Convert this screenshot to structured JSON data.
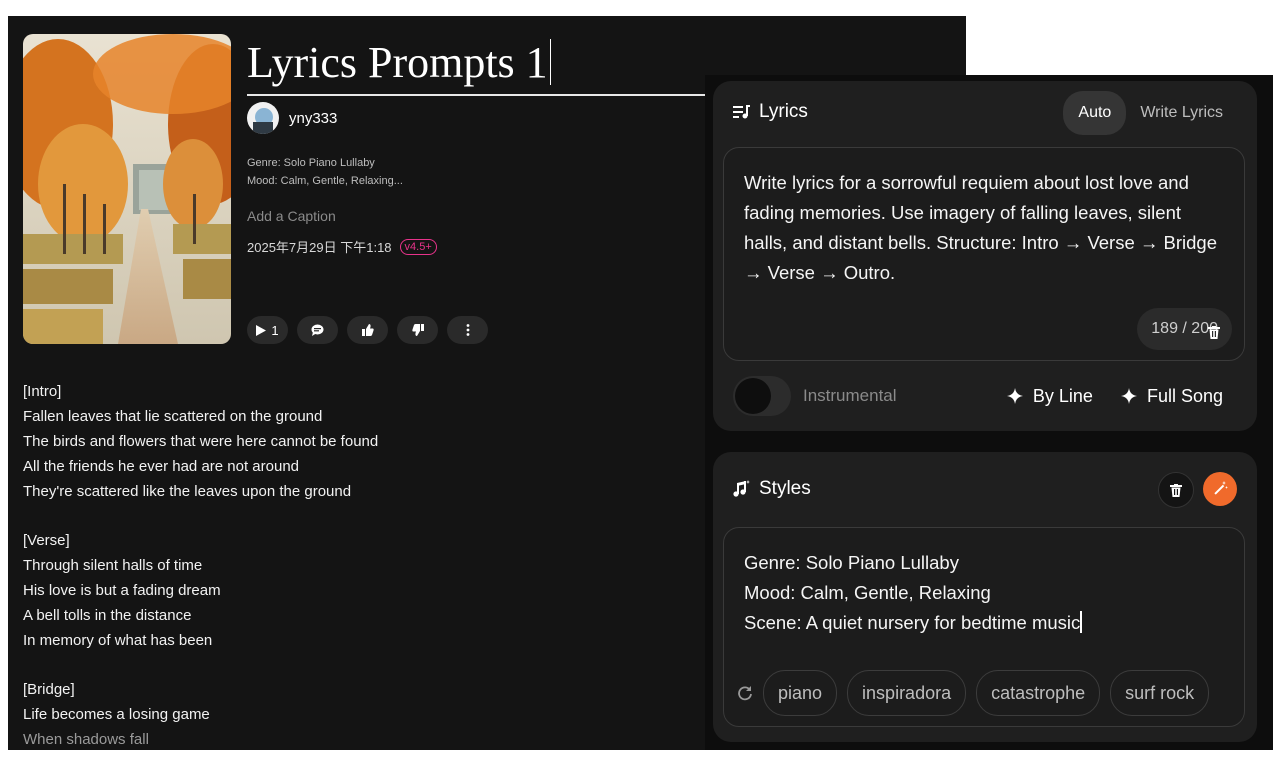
{
  "song": {
    "title": "Lyrics Prompts 1",
    "author": "yny333",
    "genre_line": "Genre: Solo Piano Lullaby",
    "mood_line": "Mood: Calm, Gentle, Relaxing...",
    "caption_placeholder": "Add a Caption",
    "date": "2025年7月29日 下午1:18",
    "version_badge": "v4.5+",
    "play_count": "1",
    "actions": {
      "play_icon": "play-icon",
      "comment_icon": "comment-icon",
      "like_icon": "thumbs-up-icon",
      "dislike_icon": "thumbs-down-icon",
      "more_icon": "more-vertical-icon"
    },
    "lyrics_lines": [
      "[Intro]",
      "Fallen leaves that lie scattered on the ground",
      "The birds and flowers that were here cannot be found",
      "All the friends he ever had are not around",
      "They're scattered like the leaves upon the ground",
      "",
      "[Verse]",
      "Through silent halls of time",
      "His love is but a fading dream",
      "A bell tolls in the distance",
      "In memory of what has been",
      "",
      "[Bridge]",
      "Life becomes a losing game",
      "When shadows fall"
    ]
  },
  "lyrics_panel": {
    "heading": "Lyrics",
    "mode_auto": "Auto",
    "mode_write": "Write Lyrics",
    "prompt": "Write lyrics for a sorrowful requiem about lost love and fading memories. Use imagery of falling leaves, silent halls, and distant bells. Structure: Intro → Verse → Bridge → Verse → Outro.",
    "counter": "189 / 200",
    "instrumental_label": "Instrumental",
    "instrumental_on": false,
    "by_line": "By Line",
    "full_song": "Full Song"
  },
  "styles_panel": {
    "heading": "Styles",
    "lines": [
      "Genre: Solo Piano Lullaby",
      "Mood: Calm, Gentle, Relaxing",
      "Scene: A quiet nursery for bedtime music"
    ],
    "tags": [
      "piano",
      "inspiradora",
      "catastrophe",
      "surf rock"
    ]
  },
  "colors": {
    "accent": "#f06a2b",
    "badge": "#e8338b",
    "panel": "#1f1f1f",
    "background": "#141414"
  }
}
